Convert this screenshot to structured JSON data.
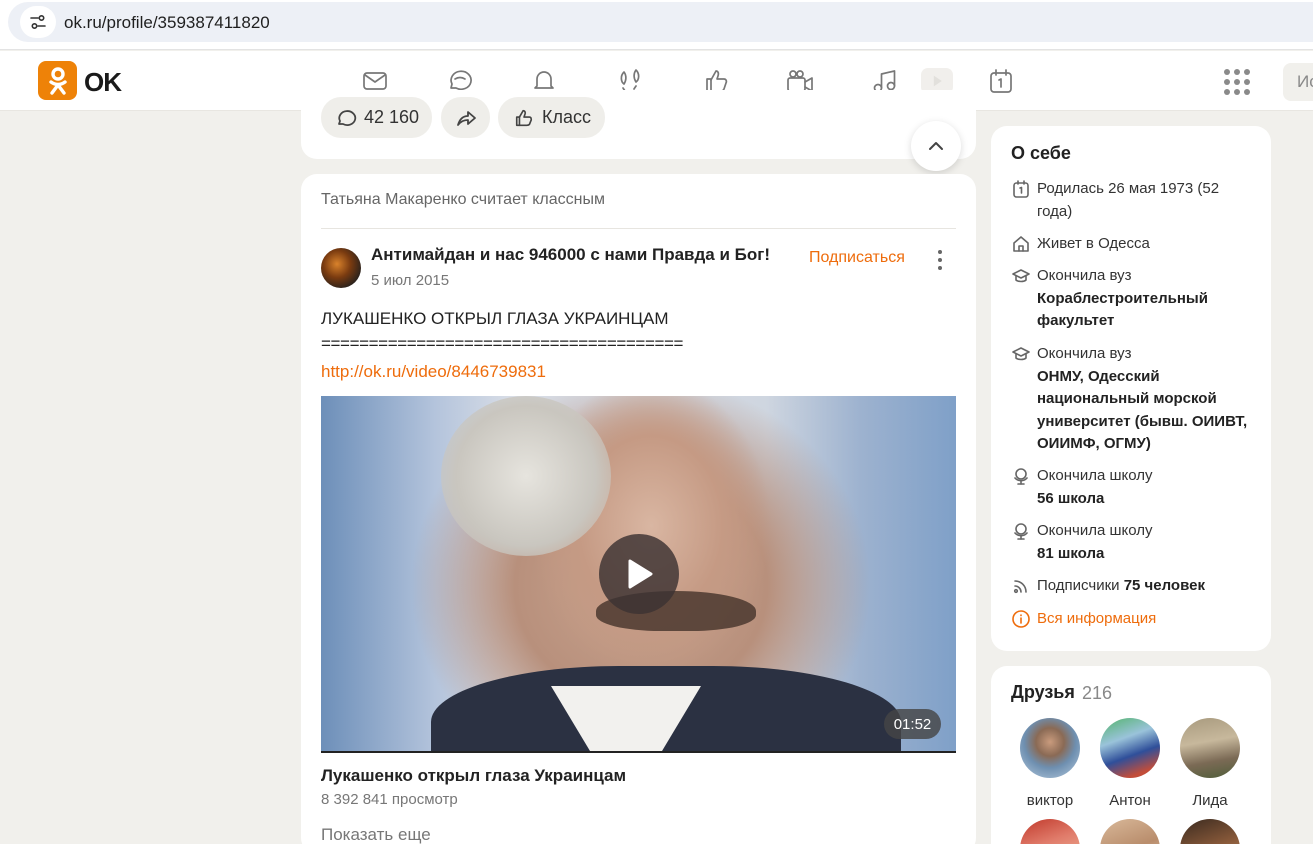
{
  "browser": {
    "url": "ok.ru/profile/359387411820"
  },
  "header": {
    "logo_text": "OK",
    "search_partial": "Ис",
    "nav_icons": [
      "mail-icon",
      "discussions-icon",
      "notifications-icon",
      "guests-icon",
      "marks-icon",
      "video-icon",
      "music-icon",
      "video-play-icon",
      "events-icon"
    ]
  },
  "feed": {
    "actions": {
      "comments_count": "42 160",
      "like_label": "Класс"
    },
    "post": {
      "liked_by": "Татьяна Макаренко считает классным",
      "group_name": "Антимайдан и нас 946000 с нами Правда и Бог!",
      "date": "5 июл 2015",
      "subscribe_label": "Подписаться",
      "text_line1": "ЛУКАШЕНКО ОТКРЫЛ ГЛАЗА УКРАИНЦАМ",
      "text_line2": "======================================",
      "link": "http://ok.ru/video/8446739831",
      "video": {
        "duration": "01:52",
        "title": "Лукашенко открыл глаза Украинцам",
        "views": "8 392 841 просмотр"
      },
      "show_more": "Показать еще"
    }
  },
  "about": {
    "title": "О себе",
    "born": "Родилась 26 мая 1973 (52 года)",
    "lives_prefix": "Живет в",
    "lives_city": "Одесса",
    "uni1_label": "Окончила вуз",
    "uni1_name": "Кораблестроительный факультет",
    "uni2_label": "Окончила вуз",
    "uni2_name": "ОНМУ, Одесский национальный морской университет (бывш. ОИИВТ, ОИИМФ, ОГМУ)",
    "school1_label": "Окончила школу",
    "school1_name": "56 школа",
    "school2_label": "Окончила школу",
    "school2_name": "81 школа",
    "subscribers_label": "Подписчики",
    "subscribers_count": "75 человек",
    "all_info": "Вся информация"
  },
  "friends": {
    "title": "Друзья",
    "count": "216",
    "items": [
      {
        "name": "виктор"
      },
      {
        "name": "Антон"
      },
      {
        "name": "Лида"
      }
    ]
  },
  "colors": {
    "accent": "#ee6c0c",
    "logo": "#ee8208",
    "page_bg": "#f1f0ec"
  }
}
